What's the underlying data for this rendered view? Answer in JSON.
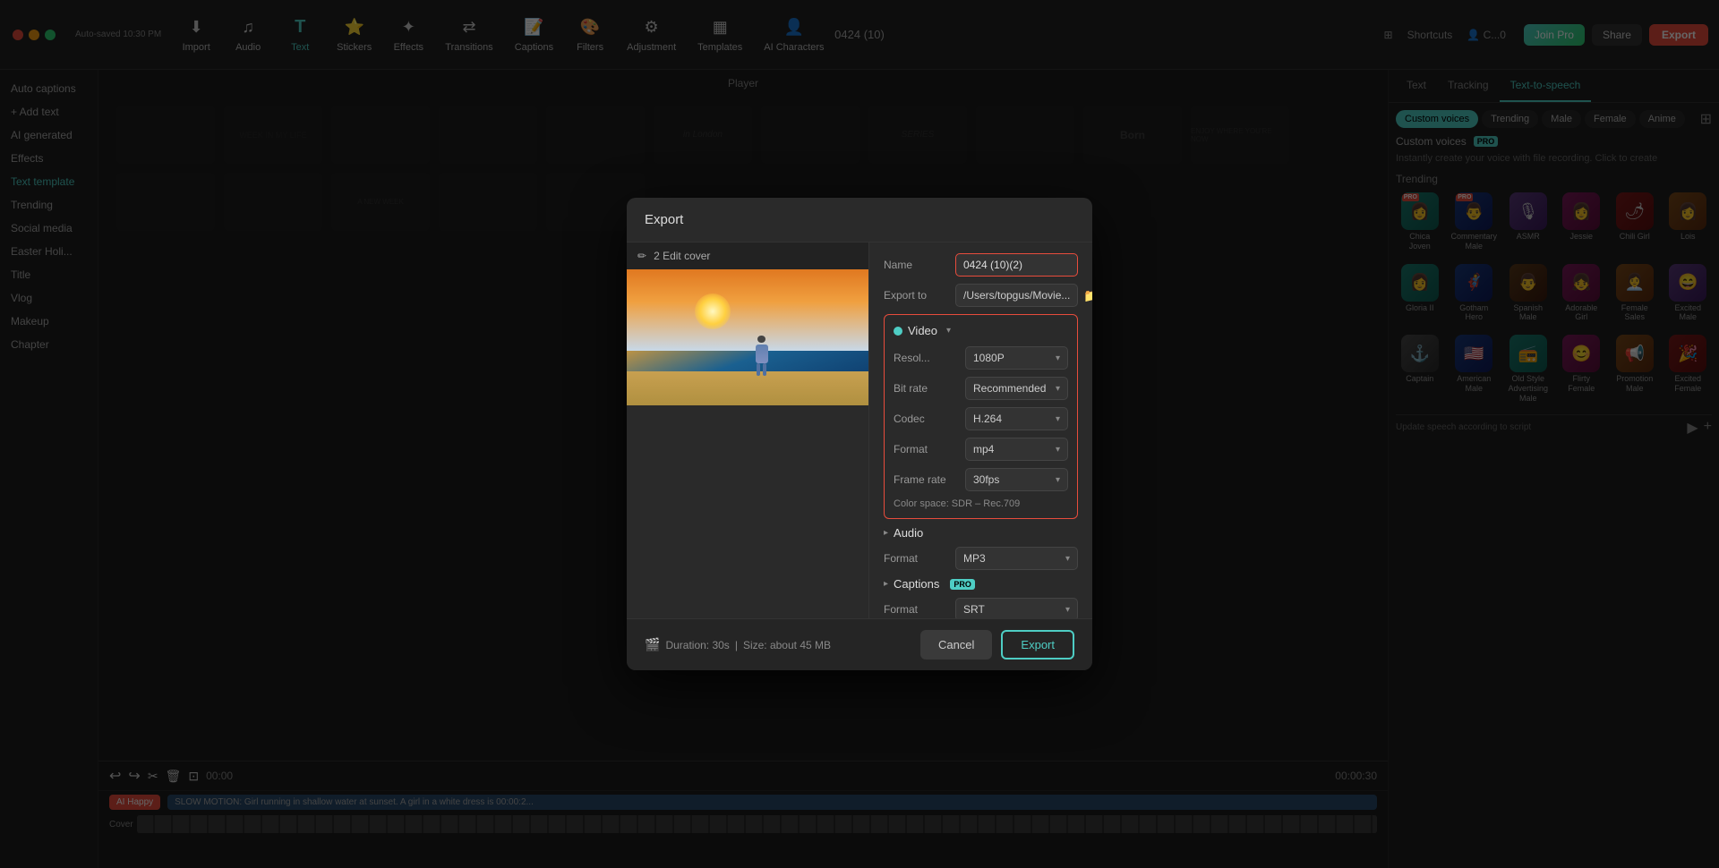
{
  "app": {
    "title": "0424 (10)",
    "window_controls": [
      "close",
      "minimize",
      "maximize"
    ],
    "auto_saved": "Auto-saved 10:30 PM"
  },
  "topbar": {
    "tools": [
      {
        "id": "import",
        "label": "Import",
        "icon": "⬇"
      },
      {
        "id": "audio",
        "label": "Audio",
        "icon": "♫"
      },
      {
        "id": "text",
        "label": "Text",
        "icon": "T",
        "active": true
      },
      {
        "id": "stickers",
        "label": "Stickers",
        "icon": "⭐"
      },
      {
        "id": "effects",
        "label": "Effects",
        "icon": "✦"
      },
      {
        "id": "transitions",
        "label": "Transitions",
        "icon": "⇄"
      },
      {
        "id": "captions",
        "label": "Captions",
        "icon": "📝"
      },
      {
        "id": "filters",
        "label": "Filters",
        "icon": "🎨"
      },
      {
        "id": "adjustment",
        "label": "Adjustment",
        "icon": "⚙"
      },
      {
        "id": "templates",
        "label": "Templates",
        "icon": "▦"
      },
      {
        "id": "ai_characters",
        "label": "AI Characters",
        "icon": "👤"
      }
    ],
    "shortcuts_label": "Shortcuts",
    "join_pro_label": "Join Pro",
    "share_label": "Share",
    "export_label": "Export"
  },
  "left_sidebar": {
    "items": [
      {
        "label": "Auto captions",
        "id": "auto-captions"
      },
      {
        "label": "+ Add text",
        "id": "add-text"
      },
      {
        "label": "AI generated",
        "id": "ai-generated"
      },
      {
        "label": "Effects",
        "id": "effects"
      },
      {
        "label": "Text template",
        "id": "text-template",
        "active": true
      },
      {
        "label": "Trending",
        "id": "trending"
      },
      {
        "label": "Social media",
        "id": "social-media"
      },
      {
        "label": "Easter Holi...",
        "id": "easter-holi"
      },
      {
        "label": "Title",
        "id": "title"
      },
      {
        "label": "Vlog",
        "id": "vlog"
      },
      {
        "label": "Makeup",
        "id": "makeup"
      },
      {
        "label": "Chapter",
        "id": "chapter"
      }
    ]
  },
  "player": {
    "label": "Player"
  },
  "right_sidebar": {
    "tabs": [
      "Text",
      "Tracking",
      "Text-to-speech"
    ],
    "active_tab": "Text-to-speech",
    "voice_filters": [
      "Custom voices",
      "Trending",
      "Male",
      "Female",
      "Anime"
    ],
    "active_filter": "Custom voices",
    "custom_voices_label": "Custom voices",
    "pro_badge": "PRO",
    "custom_voice_desc": "Instantly create your voice with file recording. Click to create",
    "section_trending": "Trending",
    "voices": [
      {
        "name": "Chica Joven",
        "color": "teal",
        "has_pro": true
      },
      {
        "name": "Commentary Male",
        "color": "blue",
        "has_pro": true
      },
      {
        "name": "ASMR",
        "color": "purple",
        "has_pro": false
      },
      {
        "name": "Jessie",
        "color": "pink",
        "has_pro": false
      },
      {
        "name": "Chili Girl",
        "color": "red",
        "has_pro": false
      },
      {
        "name": "Lois",
        "color": "orange",
        "has_pro": false
      },
      {
        "name": "Gloria II",
        "color": "teal",
        "has_pro": false
      },
      {
        "name": "Gotham Hero",
        "color": "blue",
        "has_pro": false
      },
      {
        "name": "Spanish Male",
        "color": "brown",
        "has_pro": false
      },
      {
        "name": "Adorable Girl",
        "color": "pink",
        "has_pro": false
      },
      {
        "name": "Female Sales",
        "color": "orange",
        "has_pro": false
      },
      {
        "name": "Excited Male",
        "color": "purple",
        "has_pro": false
      },
      {
        "name": "Captain",
        "color": "gray",
        "has_pro": false
      },
      {
        "name": "American Male",
        "color": "blue",
        "has_pro": false
      },
      {
        "name": "Old Style Advertising Male",
        "color": "teal",
        "has_pro": false
      },
      {
        "name": "Flirty Female",
        "color": "pink",
        "has_pro": false
      },
      {
        "name": "Promotion Male",
        "color": "orange",
        "has_pro": false
      },
      {
        "name": "Excited Female",
        "color": "red",
        "has_pro": false
      }
    ]
  },
  "modal": {
    "title": "Export",
    "preview_header": "2 Edit cover",
    "name": {
      "label": "Name",
      "value": "0424 (10)(2)"
    },
    "export_to": {
      "label": "Export to",
      "value": "/Users/topgus/Movie..."
    },
    "video_section": {
      "title": "Video",
      "resolution": {
        "label": "Resol...",
        "value": "1080P"
      },
      "bit_rate": {
        "label": "Bit rate",
        "value": "Recommended"
      },
      "codec": {
        "label": "Codec",
        "value": "H.264"
      },
      "format": {
        "label": "Format",
        "value": "mp4"
      },
      "frame_rate": {
        "label": "Frame rate",
        "value": "30fps"
      },
      "color_space": "Color space: SDR – Rec.709"
    },
    "audio_section": {
      "title": "Audio",
      "format_label": "Format",
      "format_value": "MP3"
    },
    "captions_section": {
      "title": "Captions",
      "pro_badge": "PRO",
      "format_label": "Format",
      "format_value": "SRT"
    },
    "footer": {
      "duration": "Duration: 30s",
      "size": "Size: about 45 MB",
      "cancel_label": "Cancel",
      "export_label": "Export"
    }
  },
  "timeline": {
    "caption": "SLOW MOTION: Girl running in shallow water at sunset. A girl in a white dress is   00:00:2..."
  }
}
